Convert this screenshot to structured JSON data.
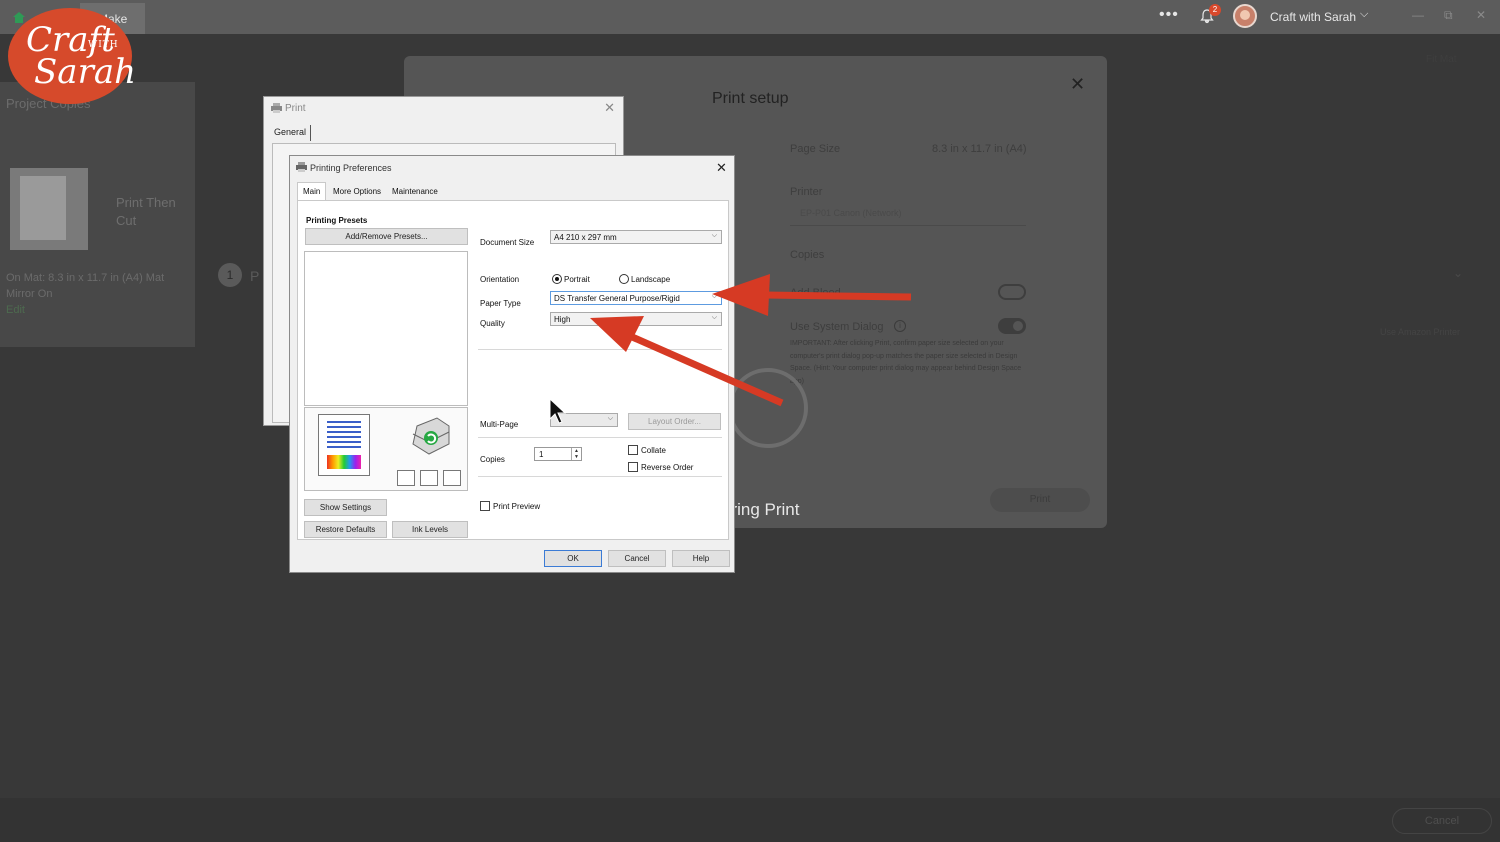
{
  "topbar": {
    "app_tab": "Make",
    "more_label": "•••",
    "notification_count": "2",
    "user_name": "Craft with Sarah",
    "user_chevron": "⌄",
    "minimize": "—",
    "restore": "⧉",
    "close": "✕"
  },
  "logo": {
    "line1": "Craft",
    "with": "WITH",
    "line2": "Sarah"
  },
  "left_panel": {
    "projects": "Project Copies",
    "project_name": "Print Then Cut",
    "mat_info": "On Mat: 8.3 in x 11.7 in (A4) Mat",
    "mirror": "Mirror On",
    "edit": "Edit",
    "step_number": "1",
    "step_text": "P"
  },
  "print_setup": {
    "title": "Print setup",
    "close": "✕",
    "page_size_label": "Page Size",
    "page_size_value": "8.3 in x 11.7 in (A4)",
    "printer_label": "Printer",
    "printer_value": "EP-P01 Canon (Network)",
    "copies_label": "Copies",
    "add_bleed_label": "Add Bleed",
    "use_system_dialog_label": "Use System Dialog",
    "note": "IMPORTANT: After clicking Print, confirm paper size selected on your computer's print dialog pop-up matches the paper size selected in Design Space. (Hint: Your computer print dialog may appear behind Design Space app)",
    "preparing": "aring Print",
    "print_button": "Print",
    "bottom_cancel": "Cancel",
    "right_note": "Use Amazon Printer",
    "top_right": "Fit Mat"
  },
  "print_dialog": {
    "title": "Print",
    "close": "✕",
    "tab": "General"
  },
  "preferences": {
    "title": "Printing Preferences",
    "close": "✕",
    "tabs": [
      "Main",
      "More Options",
      "Maintenance"
    ],
    "presets_heading": "Printing Presets",
    "add_remove_presets": "Add/Remove Presets...",
    "document_size_label": "Document Size",
    "document_size_value": "A4 210 x 297 mm",
    "orientation_label": "Orientation",
    "portrait": "Portrait",
    "landscape": "Landscape",
    "paper_type_label": "Paper Type",
    "paper_type_value": "DS Transfer General Purpose/Rigid",
    "quality_label": "Quality",
    "quality_value": "High",
    "multi_page_label": "Multi-Page",
    "multi_page_value": "",
    "layout_order": "Layout Order...",
    "copies_label": "Copies",
    "copies_value": "1",
    "collate": "Collate",
    "reverse_order": "Reverse Order",
    "print_preview": "Print Preview",
    "show_settings": "Show Settings",
    "restore_defaults": "Restore Defaults",
    "ink_levels": "Ink Levels",
    "ok": "OK",
    "cancel": "Cancel",
    "help": "Help"
  },
  "colors": {
    "accent_arrow": "#d63a24",
    "logo": "#d64a2b",
    "focus_border": "#3b7bd5"
  },
  "icons": [
    "home-icon",
    "bell-icon",
    "printer-icon",
    "cursor-icon",
    "close-icon",
    "chevron-down-icon",
    "info-icon"
  ]
}
